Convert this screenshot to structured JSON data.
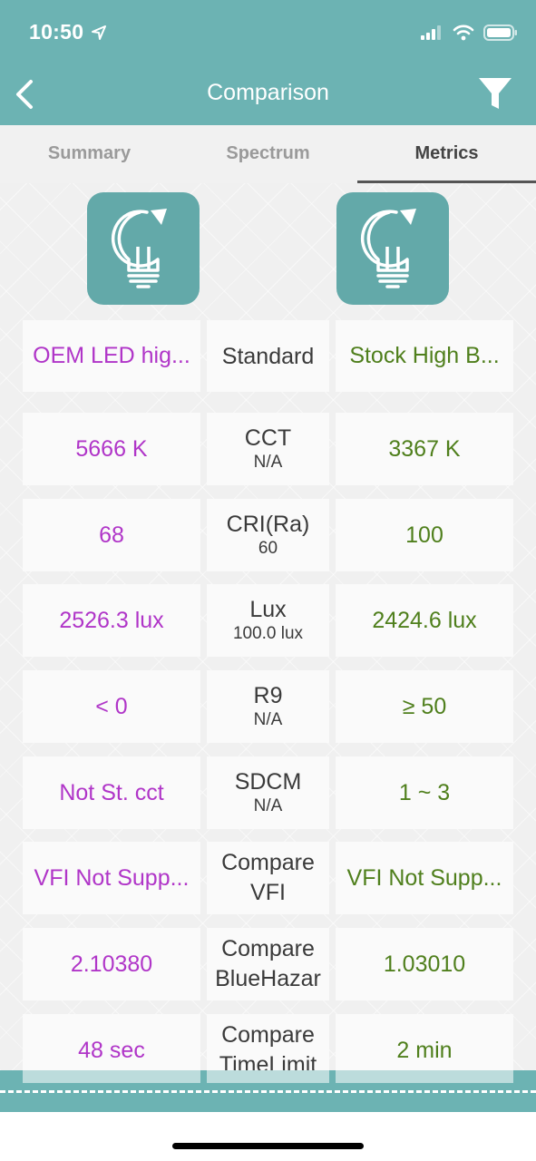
{
  "status_bar": {
    "time": "10:50"
  },
  "nav": {
    "title": "Comparison"
  },
  "tabs": [
    {
      "label": "Summary",
      "active": false
    },
    {
      "label": "Spectrum",
      "active": false
    },
    {
      "label": "Metrics",
      "active": true
    }
  ],
  "colors": {
    "header": "#6cb3b3",
    "left_value": "#b035c8",
    "right_value": "#4f7f1c"
  },
  "icons": {
    "back": "chevron-left-icon",
    "filter": "funnel-icon",
    "bulb": "lightbulb-icon"
  },
  "comparison": {
    "left_name": "OEM LED hig...",
    "standard_label": "Standard",
    "right_name": "Stock High B...",
    "rows": [
      {
        "left": "5666 K",
        "metric": "CCT",
        "standard": "N/A",
        "right": "3367 K"
      },
      {
        "left": "68",
        "metric": "CRI(Ra)",
        "standard": "60",
        "right": "100"
      },
      {
        "left": "2526.3 lux",
        "metric": "Lux",
        "standard": "100.0 lux",
        "right": "2424.6 lux"
      },
      {
        "left": "< 0",
        "metric": "R9",
        "standard": "N/A",
        "right": "≥ 50"
      },
      {
        "left": "Not St. cct",
        "metric": "SDCM",
        "standard": "N/A",
        "right": "1 ~ 3"
      },
      {
        "left": "VFI Not Supp...",
        "metric_line1": "Compare",
        "metric_line2": "VFI",
        "right": "VFI Not Supp..."
      },
      {
        "left": "2.10380",
        "metric_line1": "Compare",
        "metric_line2": "BlueHazar",
        "right": "1.03010"
      },
      {
        "left": "48 sec",
        "metric_line1": "Compare",
        "metric_line2": "TimeLimit",
        "right": "2 min"
      }
    ]
  }
}
